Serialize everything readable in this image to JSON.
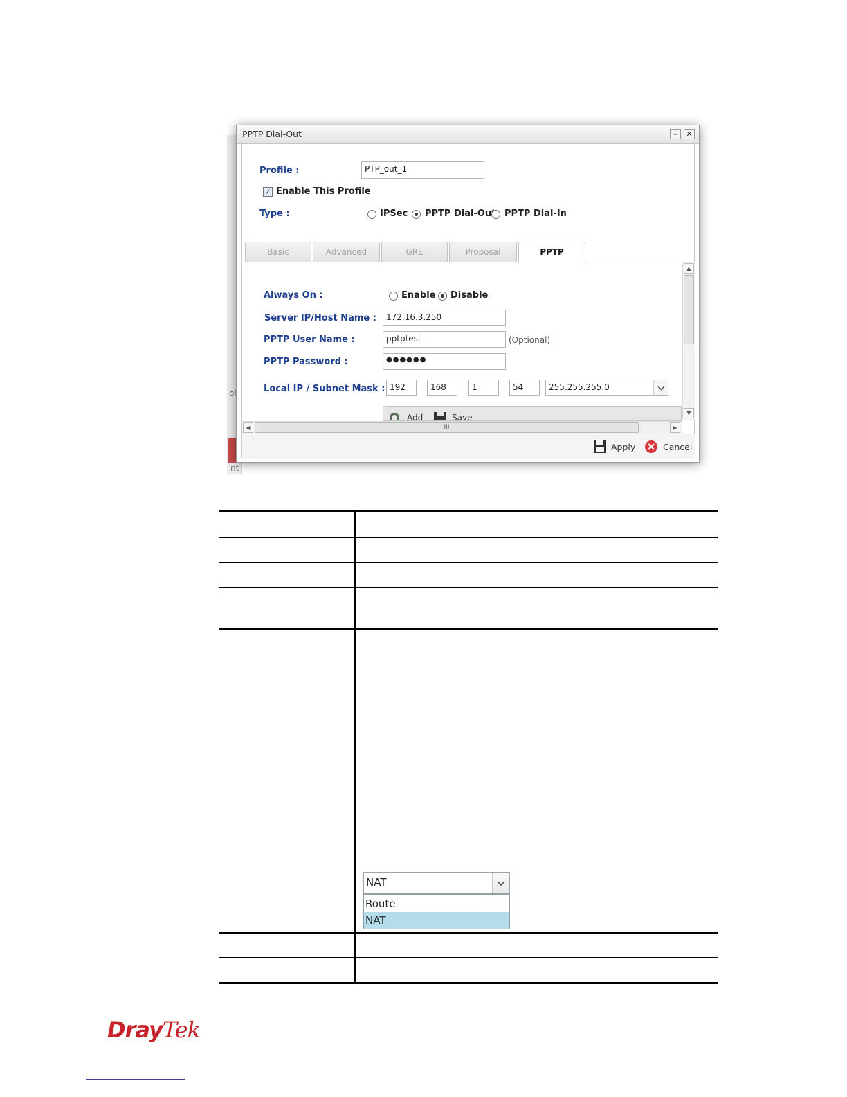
{
  "dialog": {
    "title": "PPTP Dial-Out",
    "minimize_glyph": "–",
    "close_glyph": "✕",
    "profile_label": "Profile :",
    "profile_value": "PTP_out_1",
    "enable_label": "Enable This Profile",
    "enable_checked": true,
    "type_label": "Type :",
    "type_options": [
      "IPSec",
      "PPTP Dial-Out",
      "PPTP Dial-In"
    ],
    "type_selected": "PPTP Dial-Out",
    "tabs": [
      "Basic",
      "Advanced",
      "GRE",
      "Proposal",
      "PPTP"
    ],
    "active_tab": "PPTP",
    "always_on_label": "Always On :",
    "always_on_options": [
      "Enable",
      "Disable"
    ],
    "always_on_selected": "Disable",
    "server_label": "Server IP/Host Name :",
    "server_value": "172.16.3.250",
    "user_label": "PPTP User Name :",
    "user_value": "pptptest",
    "optional_text": "(Optional)",
    "password_label": "PPTP Password :",
    "password_value": "●●●●●●",
    "local_ip_label": "Local IP / Subnet Mask :",
    "local_ip": [
      "192",
      "168",
      "1",
      "54"
    ],
    "subnet_mask": "255.255.255.0",
    "add_label": "Add",
    "save_label": "Save",
    "hscroll_grip": "III",
    "apply_label": "Apply",
    "cancel_label": "Cancel"
  },
  "mode_dropdown": {
    "selected": "NAT",
    "options": [
      "Route",
      "NAT"
    ],
    "highlighted": "NAT"
  },
  "background_fragments": {
    "left_a": "ol",
    "left_b": "nt"
  },
  "brand": {
    "logo_part1": "Dray",
    "logo_part2": "Tek",
    "color": "#c8232c"
  }
}
